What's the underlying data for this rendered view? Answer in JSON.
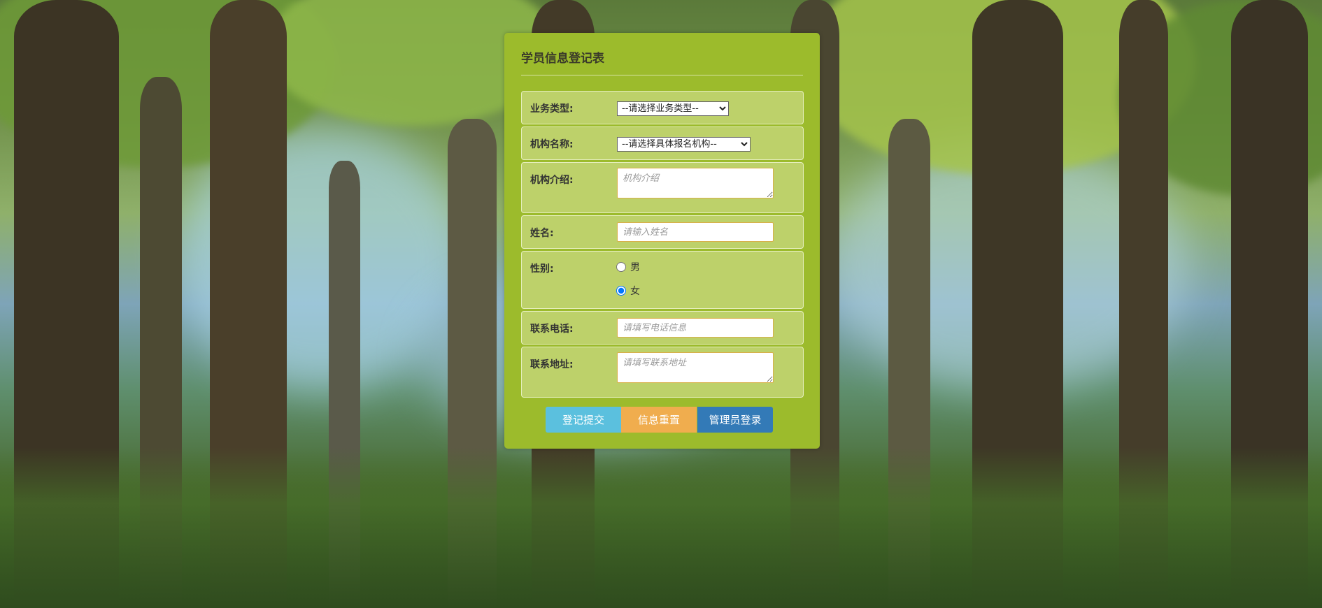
{
  "form": {
    "title": "学员信息登记表",
    "business_type": {
      "label": "业务类型:",
      "selected": "--请选择业务类型--"
    },
    "org_name": {
      "label": "机构名称:",
      "selected": "--请选择具体报名机构--"
    },
    "org_intro": {
      "label": "机构介绍:",
      "placeholder": "机构介绍"
    },
    "name": {
      "label": "姓名:",
      "placeholder": "请输入姓名"
    },
    "gender": {
      "label": "性别:",
      "options": [
        "男",
        "女"
      ],
      "selected": "女"
    },
    "phone": {
      "label": "联系电话:",
      "placeholder": "请填写电话信息"
    },
    "address": {
      "label": "联系地址:",
      "placeholder": "请填写联系地址"
    },
    "buttons": {
      "submit": "登记提交",
      "reset": "信息重置",
      "admin": "管理员登录"
    }
  },
  "colors": {
    "panel": "#9cbb2c",
    "row": "#bdd16a",
    "submit": "#5bc0de",
    "reset": "#f0ad4e",
    "admin": "#337ab7"
  }
}
